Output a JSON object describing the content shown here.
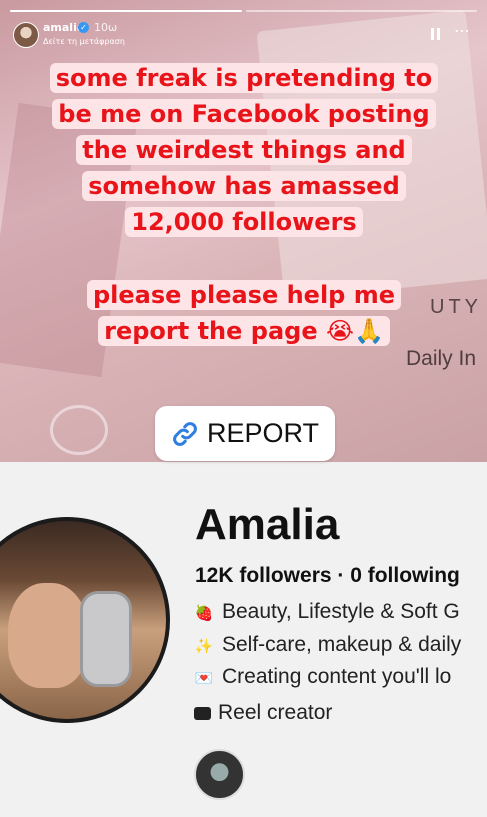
{
  "story": {
    "progress_segments": 2,
    "active_segment": 1,
    "header": {
      "username": "amalia",
      "time": "10ω",
      "translate": "Δείτε τη μετάφραση"
    },
    "caption1": [
      "some freak is pretending to",
      "be me on Facebook posting",
      "the weirdest things and",
      "somehow has amassed",
      "12,000 followers"
    ],
    "caption2": [
      "please please help me",
      "report the page 😭🙏"
    ],
    "caption_color": "#e8141a",
    "link_sticker": {
      "label": "REPORT",
      "icon": "link-icon"
    },
    "background_text": {
      "brand_fragment": "UTY",
      "tagline_fragment": "Daily In"
    }
  },
  "facebook_profile": {
    "name": "Amalia",
    "stats": "12K followers · 0 following",
    "bio": [
      {
        "icon": "strawberry-icon",
        "emoji": "🍓",
        "text": "Beauty, Lifestyle & Soft G"
      },
      {
        "icon": "sparkle-icon",
        "emoji": "✨",
        "text": "Self-care, makeup & daily"
      },
      {
        "icon": "heart-letter-icon",
        "emoji": "💌",
        "text": "Creating content you'll lo"
      }
    ],
    "category": "Reel creator",
    "category_icon": "clapper-icon"
  }
}
